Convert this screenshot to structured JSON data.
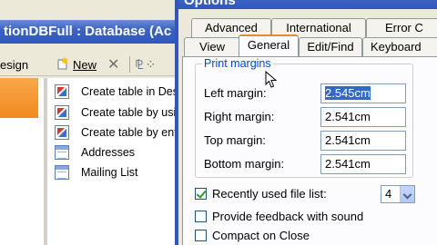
{
  "background_window": {
    "title": "tionDBFull : Database (Ac",
    "toolbar": {
      "design_label": "esign",
      "new_label": "New"
    },
    "objects": [
      {
        "label": "Create table in Des",
        "icon": "wizard-icon"
      },
      {
        "label": "Create table by usi",
        "icon": "wizard-icon"
      },
      {
        "label": "Create table by ent",
        "icon": "wizard-icon"
      },
      {
        "label": "Addresses",
        "icon": "table-icon"
      },
      {
        "label": "Mailing List",
        "icon": "table-icon"
      }
    ]
  },
  "dialog": {
    "title": "Options",
    "tabs_back": [
      {
        "label": "Advanced"
      },
      {
        "label": "International"
      },
      {
        "label": "Error C"
      }
    ],
    "tabs_front": [
      {
        "label": "View"
      },
      {
        "label": "General"
      },
      {
        "label": "Edit/Find"
      },
      {
        "label": "Keyboard"
      }
    ],
    "active_tab": "General",
    "print_margins": {
      "legend": "Print margins",
      "left_label": "Left margin:",
      "left_value": "2.545cm",
      "right_label": "Right margin:",
      "right_value": "2.541cm",
      "top_label": "Top margin:",
      "top_value": "2.541cm",
      "bottom_label": "Bottom margin:",
      "bottom_value": "2.541cm"
    },
    "options": {
      "recent_files_label": "Recently used file list:",
      "recent_files_checked": true,
      "recent_files_count": "4",
      "feedback_label": "Provide feedback with sound",
      "feedback_checked": false,
      "compact_label": "Compact on Close",
      "compact_checked": false
    }
  }
}
